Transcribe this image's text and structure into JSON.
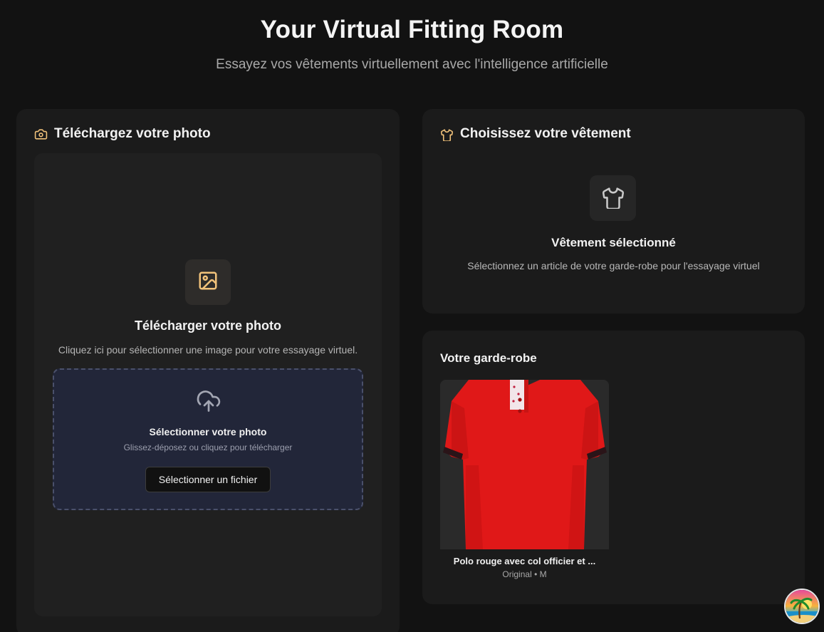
{
  "header": {
    "title": "Your Virtual Fitting Room",
    "subtitle": "Essayez vos vêtements virtuellement avec l'intelligence artificielle"
  },
  "upload_card": {
    "heading": "Téléchargez votre photo",
    "heading_icon": "camera-icon",
    "placeholder_icon": "image-icon",
    "title": "Télécharger votre photo",
    "description": "Cliquez ici pour sélectionner une image pour votre essayage virtuel.",
    "dropzone": {
      "icon": "cloud-upload-icon",
      "title": "Sélectionner votre photo",
      "hint": "Glissez-déposez ou cliquez pour télécharger",
      "button_label": "Sélectionner un fichier"
    }
  },
  "garment_card": {
    "heading": "Choisissez votre vêtement",
    "heading_icon": "shirt-icon",
    "placeholder_icon": "shirt-icon",
    "title": "Vêtement sélectionné",
    "description": "Sélectionnez un article de votre garde-robe pour l'essayage virtuel"
  },
  "wardrobe": {
    "heading": "Votre garde-robe",
    "items": [
      {
        "name": "Polo rouge avec col officier et ...",
        "meta": "Original • M",
        "color": "#e21414"
      }
    ]
  },
  "colors": {
    "background": "#121212",
    "card": "#1b1b1b",
    "accent": "#f1c27a",
    "dropzone": "#222639"
  },
  "avatar": {
    "icon": "beach-palm-avatar-icon"
  }
}
